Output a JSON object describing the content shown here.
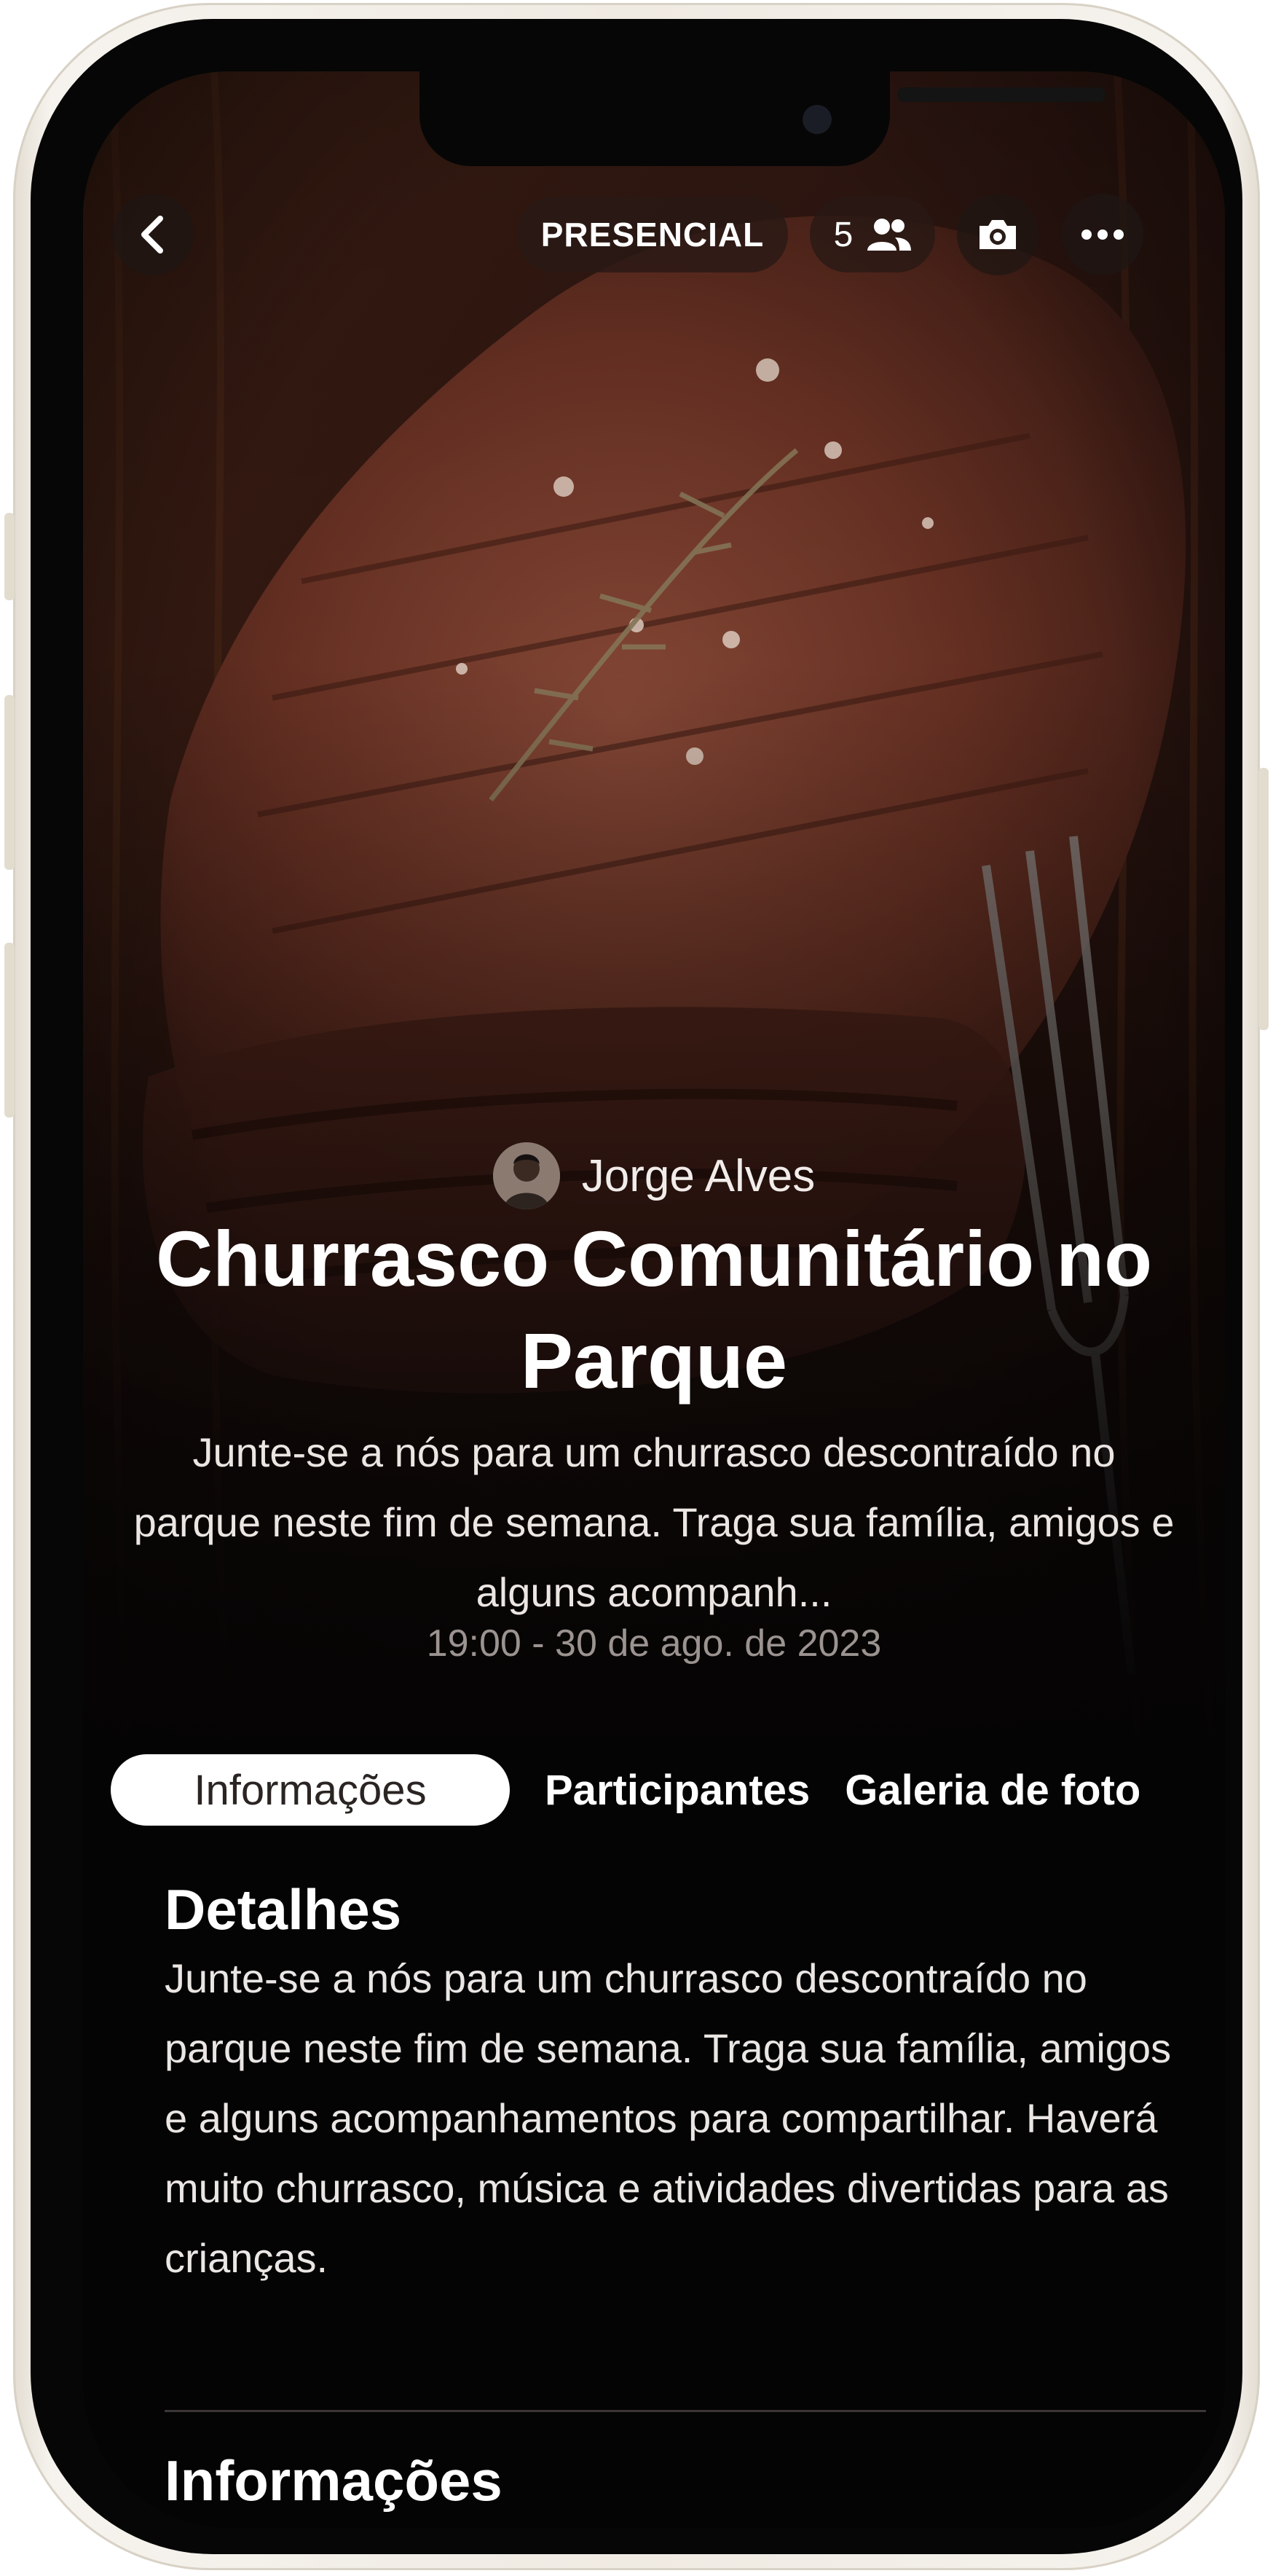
{
  "event": {
    "mode_badge": "PRESENCIAL",
    "participants_count": "5",
    "host_name": "Jorge Alves",
    "title": "Churrasco Comunitário no Parque",
    "short_description": "Junte-se a nós para um churrasco descontraído no parque neste fim de semana. Traga sua família, amigos e alguns acompanh...",
    "date_time": "19:00 - 30 de ago. de 2023"
  },
  "tabs": [
    "Informações",
    "Participantes",
    "Galeria de foto"
  ],
  "details": {
    "heading": "Detalhes",
    "text": "Junte-se a nós para um churrasco descontraído no parque neste fim de semana. Traga sua família, amigos e alguns acompanhamentos para compartilhar. Haverá muito churrasco, música e atividades divertidas para as crianças."
  },
  "info_section": {
    "heading": "Informações"
  },
  "icons": {
    "back": "chevron-left-icon",
    "participants": "people-icon",
    "camera": "camera-icon",
    "more": "more-horizontal-icon"
  },
  "colors": {
    "background": "#050404",
    "active_tab_bg": "#ffffff",
    "badge_bg": "#3a2420"
  }
}
